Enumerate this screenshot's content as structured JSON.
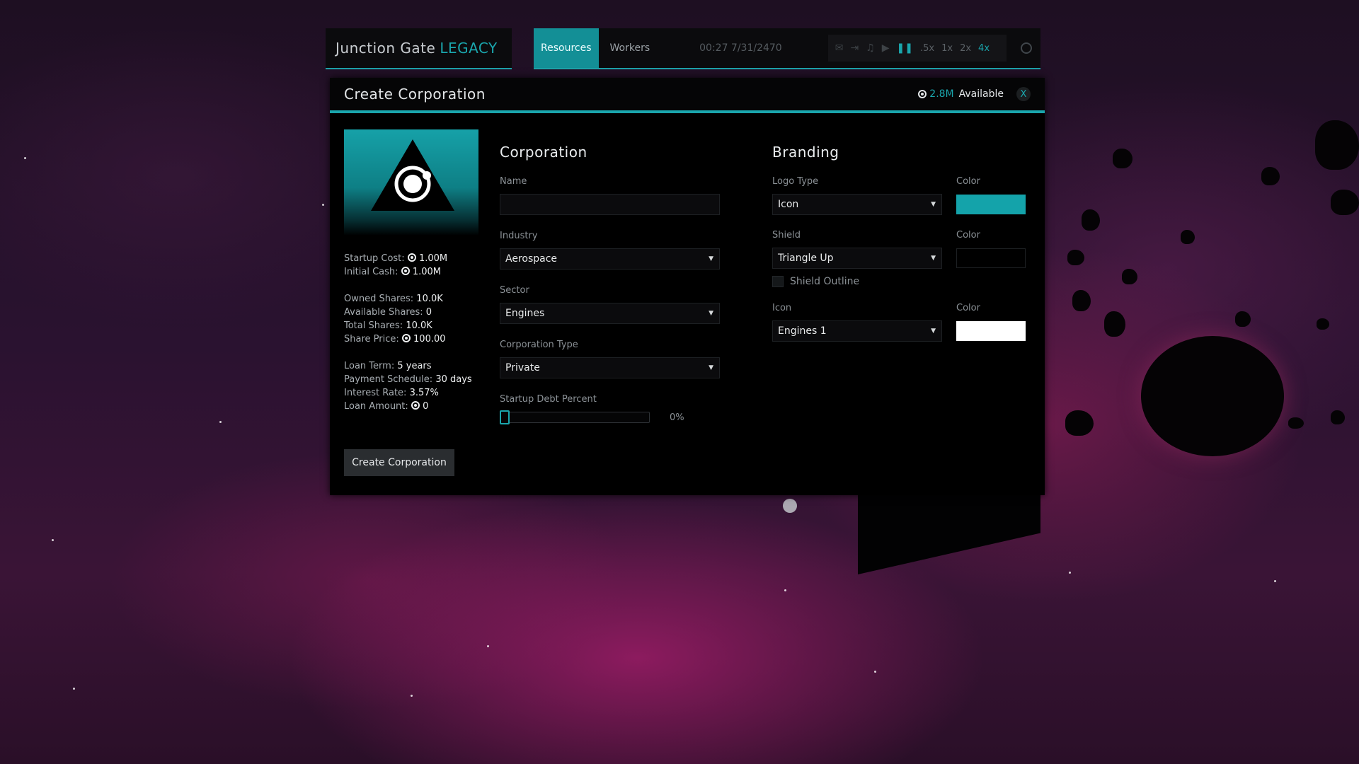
{
  "app": {
    "logo_main": "Junction Gate",
    "logo_accent": "LEGACY"
  },
  "topbar": {
    "tabs": [
      {
        "label": "Resources",
        "active": true
      },
      {
        "label": "Workers",
        "active": false
      }
    ],
    "clock": "00:27 7/31/2470",
    "speeds": [
      ".5x",
      "1x",
      "2x",
      "4x"
    ],
    "active_speed": "4x",
    "icons": [
      "mail-icon",
      "skip-icon",
      "music-icon",
      "play-icon",
      "pause-icon",
      "settings-icon"
    ]
  },
  "modal": {
    "title": "Create Corporation",
    "available_amount": "2.8M",
    "available_label": "Available",
    "close_label": "X",
    "stats": {
      "startup_cost_label": "Startup Cost:",
      "startup_cost_value": "1.00M",
      "initial_cash_label": "Initial Cash:",
      "initial_cash_value": "1.00M",
      "owned_shares_label": "Owned Shares:",
      "owned_shares_value": "10.0K",
      "available_shares_label": "Available Shares:",
      "available_shares_value": "0",
      "total_shares_label": "Total Shares:",
      "total_shares_value": "10.0K",
      "share_price_label": "Share Price:",
      "share_price_value": "100.00",
      "loan_term_label": "Loan Term:",
      "loan_term_value": "5 years",
      "payment_schedule_label": "Payment Schedule:",
      "payment_schedule_value": "30 days",
      "interest_rate_label": "Interest Rate:",
      "interest_rate_value": "3.57%",
      "loan_amount_label": "Loan Amount:",
      "loan_amount_value": "0"
    },
    "create_button": "Create Corporation",
    "corporation": {
      "title": "Corporation",
      "name_label": "Name",
      "name_value": "",
      "industry_label": "Industry",
      "industry_value": "Aerospace",
      "sector_label": "Sector",
      "sector_value": "Engines",
      "type_label": "Corporation Type",
      "type_value": "Private",
      "debt_label": "Startup Debt Percent",
      "debt_value": "0%",
      "debt_fraction": 0
    },
    "branding": {
      "title": "Branding",
      "logo_type_label": "Logo Type",
      "logo_type_value": "Icon",
      "shield_label": "Shield",
      "shield_value": "Triangle Up",
      "shield_outline_label": "Shield Outline",
      "icon_label": "Icon",
      "icon_value": "Engines 1",
      "color_label": "Color",
      "logo_color": "#14a3aa",
      "shield_color": "#000000",
      "icon_color": "#ffffff"
    }
  }
}
